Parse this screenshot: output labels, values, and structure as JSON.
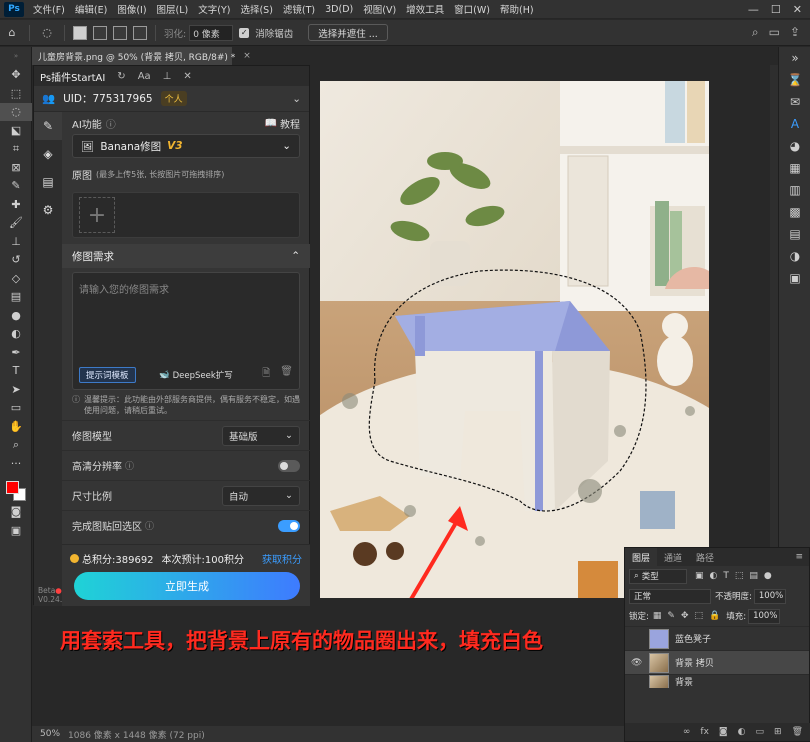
{
  "menubar": {
    "logo": "Ps",
    "items": [
      "文件(F)",
      "编辑(E)",
      "图像(I)",
      "图层(L)",
      "文字(Y)",
      "选择(S)",
      "滤镜(T)",
      "3D(D)",
      "视图(V)",
      "增效工具",
      "窗口(W)",
      "帮助(H)"
    ],
    "win_min": "—",
    "win_max": "☐",
    "win_close": "✕"
  },
  "options": {
    "feather_label": "羽化:",
    "feather_value": "0 像素",
    "antialias_label": "消除锯齿",
    "select_mask_btn": "选择并遮住 ..."
  },
  "document": {
    "tab_title": "儿童房背景.png @ 50% (背景 拷贝, RGB/8#) *",
    "close": "×"
  },
  "status": {
    "zoom": "50%",
    "info": "1086 像素 x 1448 像素 (72 ppi)"
  },
  "plugin": {
    "title": "Ps插件StartAI",
    "uid": "UID：775317965",
    "account_type": "个人",
    "ai_function_label": "AI功能",
    "tutorial_label": "教程",
    "mode_select": "Banana修图",
    "mode_version": "V3",
    "source_label": "原图",
    "source_hint": "(最多上传5张, 长按图片可拖拽排序)",
    "requirement_label": "修图需求",
    "requirement_placeholder": "请输入您的修图需求",
    "prompt_template_btn": "提示词模板",
    "deepseek_btn": "DeepSeek扩写",
    "tip": "温馨提示：此功能由外部服务商提供，偶有服务不稳定，如遇使用问题，请稍后重试。",
    "model_label": "修图模型",
    "model_value": "基础版",
    "hd_label": "高清分辨率",
    "ratio_label": "尺寸比例",
    "ratio_value": "自动",
    "paste_label": "完成图贴回选区",
    "total_points": "总积分:389692",
    "estimate": "本次预计:100积分",
    "get_points": "获取积分",
    "generate_btn": "立即生成",
    "beta_label": "Beta",
    "version": "V0.24.2"
  },
  "layers": {
    "tabs": [
      "图层",
      "通道",
      "路径"
    ],
    "filter_label": "类型",
    "blend_mode": "正常",
    "opacity_label": "不透明度:",
    "opacity_value": "100%",
    "lock_label": "锁定:",
    "fill_label": "填充:",
    "fill_value": "100%",
    "items": [
      "蓝色凳子",
      "背景 拷贝",
      "背景"
    ]
  },
  "caption": "用套索工具，把背景上原有的物品圈出来，填充白色"
}
